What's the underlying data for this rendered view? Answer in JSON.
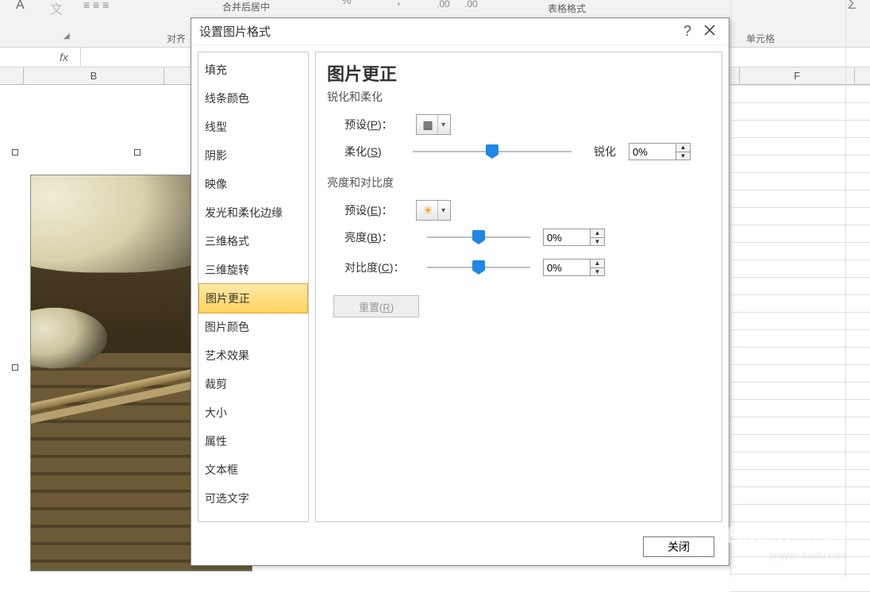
{
  "ribbon": {
    "merge_center": "合并后居中",
    "table_format": "表格格式",
    "group_align": "对齐",
    "group_cell": "单元格",
    "a_char": "A",
    "wen": "文",
    "decimals": ".00",
    "decimals2": ".00"
  },
  "formula": {
    "fx": "fx"
  },
  "columns": {
    "b": "B",
    "f": "F"
  },
  "dialog": {
    "title": "设置图片格式",
    "help": "?",
    "sidebar": [
      "填充",
      "线条颜色",
      "线型",
      "阴影",
      "映像",
      "发光和柔化边缘",
      "三维格式",
      "三维旋转",
      "图片更正",
      "图片颜色",
      "艺术效果",
      "裁剪",
      "大小",
      "属性",
      "文本框",
      "可选文字"
    ],
    "sidebar_selected_index": 8,
    "main": {
      "title": "图片更正",
      "section1": "锐化和柔化",
      "section2": "亮度和对比度",
      "preset1_label": "预设(P)：",
      "preset2_label": "预设(E)：",
      "soften": "柔化(S)",
      "sharpen": "锐化",
      "brightness": "亮度(B)：",
      "contrast": "对比度(C)：",
      "reset": "重置(R)",
      "val_sharpen": "0%",
      "val_brightness": "0%",
      "val_contrast": "0%"
    },
    "close": "关闭"
  },
  "watermark": {
    "brand": "Baidu 经验",
    "url": "jingyan.baidu.com"
  }
}
